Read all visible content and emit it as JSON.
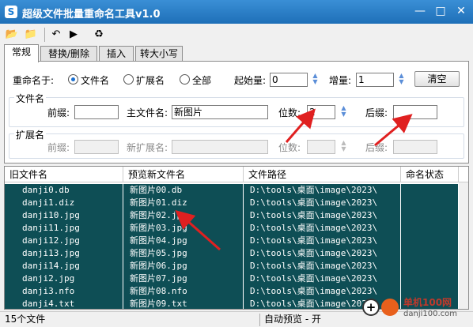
{
  "window": {
    "title": "超级文件批量重命名工具v1.0",
    "app_icon": "S",
    "min": "—",
    "max": "□",
    "close": "✕"
  },
  "toolbar": {
    "icons": [
      "open-folder-icon",
      "open-file-icon",
      "undo-icon",
      "run-icon",
      "recycle-icon"
    ],
    "glyphs": [
      "📂",
      "📁",
      "↶",
      "▶",
      "♻"
    ],
    "colors": [
      "#2a6fc0",
      "#2a6fc0",
      "#2a6fc0",
      "#1faa3c",
      "#1faa3c"
    ]
  },
  "tabs": [
    "常规",
    "替换/删除",
    "插入",
    "转大小写"
  ],
  "general": {
    "rename_to_label": "重命名于:",
    "options": [
      "文件名",
      "扩展名",
      "全部"
    ],
    "selected_option": "文件名",
    "start_label": "起始量:",
    "start_value": "0",
    "step_label": "增量:",
    "step_value": "1",
    "clear_button": "清空"
  },
  "filename_group": {
    "title": "文件名",
    "prefix_label": "前缀:",
    "prefix_value": "",
    "mainname_label": "主文件名:",
    "mainname_value": "新图片",
    "digits_label": "位数:",
    "digits_value": "2",
    "suffix_label": "后缀:",
    "suffix_value": ""
  },
  "ext_group": {
    "title": "扩展名",
    "prefix_label": "前缀:",
    "prefix_value": "",
    "newext_label": "新扩展名:",
    "newext_value": "",
    "digits_label": "位数:",
    "digits_value": "",
    "suffix_label": "后缀:",
    "suffix_value": ""
  },
  "grid": {
    "columns": [
      "旧文件名",
      "预览新文件名",
      "文件路径",
      "命名状态"
    ],
    "rows": [
      [
        "danji0.db",
        "新图片00.db",
        "D:\\tools\\桌面\\image\\2023\\",
        ""
      ],
      [
        "danji1.diz",
        "新图片01.diz",
        "D:\\tools\\桌面\\image\\2023\\",
        ""
      ],
      [
        "danji10.jpg",
        "新图片02.jpg",
        "D:\\tools\\桌面\\image\\2023\\",
        ""
      ],
      [
        "danji11.jpg",
        "新图片03.jpg",
        "D:\\tools\\桌面\\image\\2023\\",
        ""
      ],
      [
        "danji12.jpg",
        "新图片04.jpg",
        "D:\\tools\\桌面\\image\\2023\\",
        ""
      ],
      [
        "danji13.jpg",
        "新图片05.jpg",
        "D:\\tools\\桌面\\image\\2023\\",
        ""
      ],
      [
        "danji14.jpg",
        "新图片06.jpg",
        "D:\\tools\\桌面\\image\\2023\\",
        ""
      ],
      [
        "danji2.jpg",
        "新图片07.jpg",
        "D:\\tools\\桌面\\image\\2023\\",
        ""
      ],
      [
        "danji3.nfo",
        "新图片08.nfo",
        "D:\\tools\\桌面\\image\\2023\\",
        ""
      ],
      [
        "danji4.txt",
        "新图片09.txt",
        "D:\\tools\\桌面\\image\\2023\\",
        ""
      ]
    ]
  },
  "status": {
    "file_count": "15个文件",
    "auto_preview": "自动预览 - 开"
  },
  "watermark": {
    "site": "单机100网",
    "url": "danji100.com"
  },
  "colors": {
    "title_bar": "#1e6fb8",
    "row_bg": "#0e4e55",
    "arrow": "#e02020"
  }
}
